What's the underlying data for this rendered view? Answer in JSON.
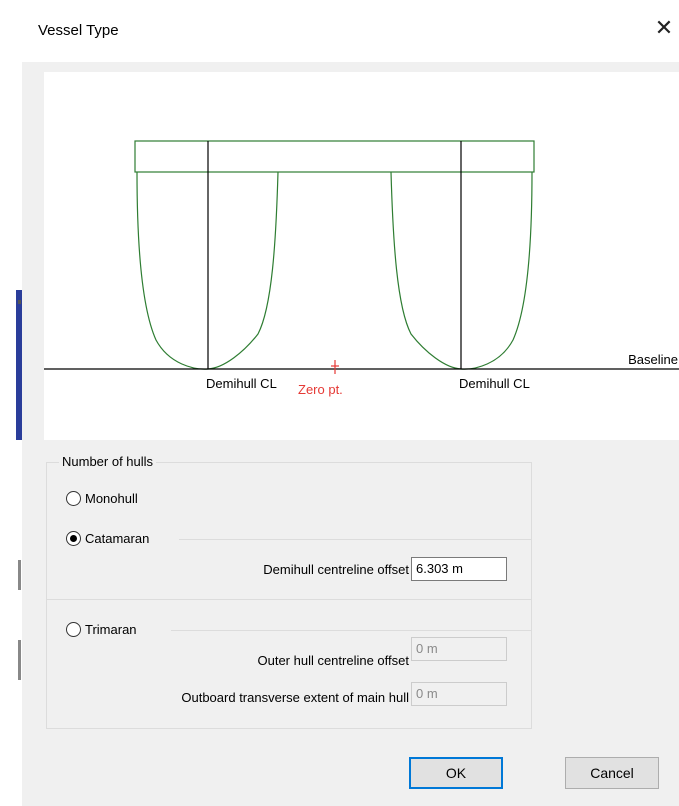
{
  "dialog": {
    "title": "Vessel Type",
    "close_glyph": "✕"
  },
  "preview": {
    "baseline_label": "Baseline",
    "left_demihull_label": "Demihull CL",
    "right_demihull_label": "Demihull CL",
    "zero_label": "Zero pt.",
    "colors": {
      "hull": "#2e7d32",
      "zero": "#e53935",
      "lines": "#000000"
    }
  },
  "hulls_group": {
    "label": "Number of hulls",
    "monohull_label": "Monohull",
    "catamaran_label": "Catamaran",
    "trimaran_label": "Trimaran",
    "selected": "Catamaran",
    "demihull_offset_label": "Demihull centreline offset",
    "demihull_offset_value": "6.303 m",
    "outer_hull_offset_label": "Outer hull centreline offset",
    "outer_hull_offset_value": "0 m",
    "outboard_extent_label": "Outboard transverse extent of main hull",
    "outboard_extent_value": "0 m"
  },
  "buttons": {
    "ok": "OK",
    "cancel": "Cancel"
  }
}
